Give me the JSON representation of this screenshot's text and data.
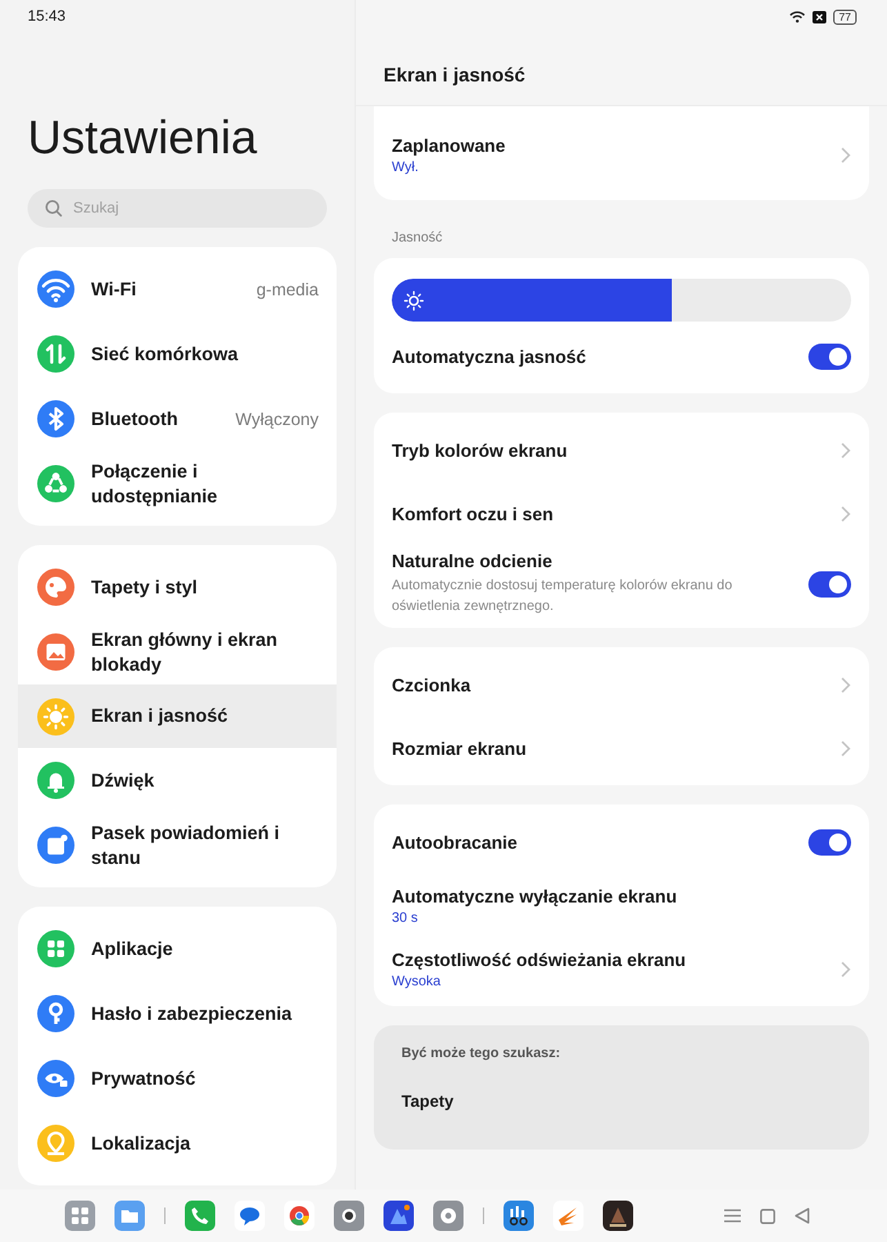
{
  "status_bar": {
    "time": "15:43",
    "battery": "77"
  },
  "sidebar": {
    "title": "Ustawienia",
    "search": {
      "placeholder": "Szukaj"
    },
    "groups": [
      {
        "items": [
          {
            "label": "Wi-Fi",
            "value": "g-media",
            "color": "#2f7cf6",
            "selected": false
          },
          {
            "label": "Sieć komórkowa",
            "color": "#22c160",
            "selected": false
          },
          {
            "label": "Bluetooth",
            "value": "Wyłączony",
            "color": "#2f7cf6",
            "selected": false
          },
          {
            "label": "Połączenie i udostępnianie",
            "color": "#22c160",
            "selected": false
          }
        ]
      },
      {
        "items": [
          {
            "label": "Tapety i styl",
            "color": "#f26b43",
            "selected": false
          },
          {
            "label": "Ekran główny i ekran blokady",
            "color": "#f26b43",
            "selected": false
          },
          {
            "label": "Ekran i jasność",
            "color": "#fbbf1c",
            "selected": true
          },
          {
            "label": "Dźwięk",
            "color": "#22c160",
            "selected": false
          },
          {
            "label": "Pasek powiadomień i stanu",
            "color": "#2f7cf6",
            "selected": false
          }
        ]
      },
      {
        "items": [
          {
            "label": "Aplikacje",
            "color": "#22c160",
            "selected": false
          },
          {
            "label": "Hasło i zabezpieczenia",
            "color": "#2f7cf6",
            "selected": false
          },
          {
            "label": "Prywatność",
            "color": "#2f7cf6",
            "selected": false
          },
          {
            "label": "Lokalizacja",
            "color": "#fbbf1c",
            "selected": false
          }
        ]
      }
    ]
  },
  "detail": {
    "title": "Ekran i jasność",
    "sections": [
      {
        "rows": [
          {
            "kind": "link",
            "title": "Zaplanowane",
            "value": "Wył."
          }
        ]
      },
      {
        "label": "Jasność",
        "rows": [
          {
            "kind": "slider",
            "level": 0.61
          },
          {
            "kind": "toggle",
            "title": "Automatyczna jasność",
            "on": true
          }
        ]
      },
      {
        "rows": [
          {
            "kind": "link",
            "title": "Tryb kolorów ekranu"
          },
          {
            "kind": "link",
            "title": "Komfort oczu i sen"
          },
          {
            "kind": "toggle",
            "title": "Naturalne odcienie",
            "description": "Automatycznie dostosuj temperaturę kolorów ekranu do oświetlenia zewnętrznego.",
            "on": true
          }
        ]
      },
      {
        "rows": [
          {
            "kind": "link",
            "title": "Czcionka"
          },
          {
            "kind": "link",
            "title": "Rozmiar ekranu"
          }
        ]
      },
      {
        "rows": [
          {
            "kind": "toggle",
            "title": "Autoobracanie",
            "on": true
          },
          {
            "kind": "info",
            "title": "Automatyczne wyłączanie ekranu",
            "value": "30 s"
          },
          {
            "kind": "link",
            "title": "Częstotliwość odświeżania ekranu",
            "value": "Wysoka"
          }
        ]
      }
    ],
    "suggestions": {
      "heading": "Być może tego szukasz:",
      "items": [
        "Tapety"
      ]
    }
  }
}
